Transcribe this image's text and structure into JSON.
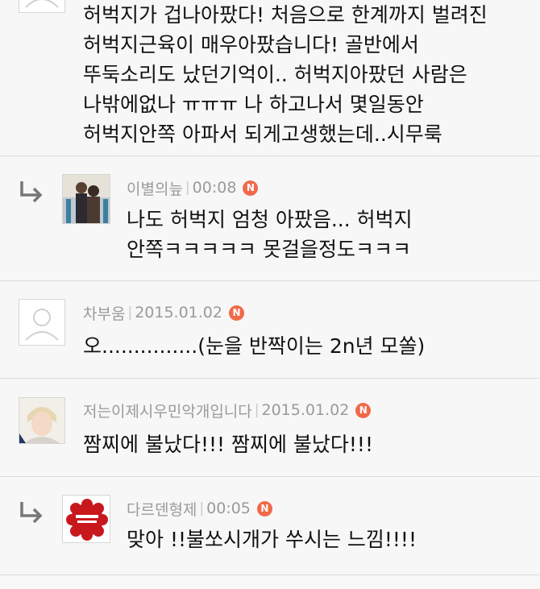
{
  "comments": [
    {
      "author": "",
      "time": "",
      "badge": "",
      "text": "허벅지가 겁나아팠다! 처음으로 한계까지 벌려진\n허벅지근육이 매우아팠습니다! 골반에서\n뚜둑소리도 났던기억이.. 허벅지아팠던 사람은\n나밖에없나 ㅠㅠㅠ 나 하고나서 몇일동안\n허벅지안쪽 아파서 되게고생했는데..시무룩"
    },
    {
      "author": "이별의늪",
      "time": "00:08",
      "badge": "N",
      "text": "나도 허벅지 엄청 아팠음... 허벅지\n안쪽ㅋㅋㅋㅋㅋ 못걸을정도ㅋㅋㅋ"
    },
    {
      "author": "차부움",
      "time": "2015.01.02",
      "badge": "N",
      "text": "오...............(눈을 반짝이는 2n년 모쏠)"
    },
    {
      "author": "저는이제시우민악개입니다",
      "time": "2015.01.02",
      "badge": "N",
      "text": "짬찌에 불났다!!! 짬찌에 불났다!!!"
    },
    {
      "author": "다르덴형제",
      "time": "00:05",
      "badge": "N",
      "text": "맞아 !!불쏘시개가 쑤시는 느낌!!!!"
    }
  ],
  "colors": {
    "background": "#f7f7f7",
    "badge": "#f06a4a",
    "meta_text": "#9a9a9a",
    "divider": "#dcdcdc"
  },
  "icons": {
    "reply": "reply-arrow-icon",
    "default_avatar": "default-user-icon"
  }
}
